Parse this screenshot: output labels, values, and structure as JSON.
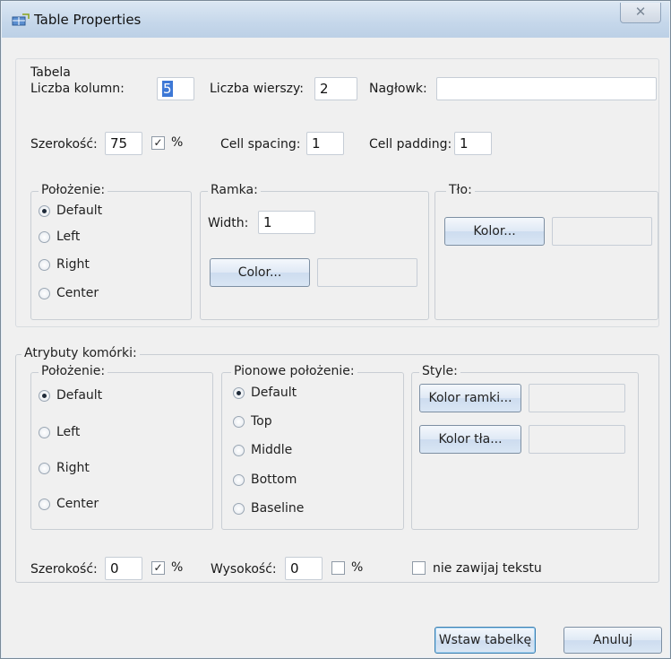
{
  "window": {
    "title": "Table Properties",
    "close_glyph": "✕"
  },
  "tabela": {
    "heading": "Tabela",
    "columns_label": "Liczba kolumn:",
    "columns_value": "5",
    "rows_label": "Liczba wierszy:",
    "rows_value": "2",
    "header_label": "Nagłowk:",
    "header_value": "",
    "width_label": "Szerokość:",
    "width_value": "75",
    "width_percent_checked": true,
    "percent_sign": "%",
    "spacing_label": "Cell spacing:",
    "spacing_value": "1",
    "padding_label": "Cell padding:",
    "padding_value": "1"
  },
  "polozenie": {
    "legend": "Położenie:",
    "options": [
      "Default",
      "Left",
      "Right",
      "Center"
    ],
    "selected": "Default"
  },
  "ramka": {
    "legend": "Ramka:",
    "width_label": "Width:",
    "width_value": "1",
    "color_button": "Color..."
  },
  "tlo": {
    "legend": "Tło:",
    "color_button": "Kolor..."
  },
  "atrybuty": {
    "legend": "Atrybuty komórki:",
    "polozenie": {
      "legend": "Położenie:",
      "options": [
        "Default",
        "Left",
        "Right",
        "Center"
      ],
      "selected": "Default"
    },
    "pionowe": {
      "legend": "Pionowe położenie:",
      "options": [
        "Default",
        "Top",
        "Middle",
        "Bottom",
        "Baseline"
      ],
      "selected": "Default"
    },
    "style": {
      "legend": "Style:",
      "border_color_button": "Kolor ramki...",
      "bg_color_button": "Kolor tła..."
    }
  },
  "cell_size": {
    "width_label": "Szerokość:",
    "width_value": "0",
    "width_percent_checked": true,
    "height_label": "Wysokość:",
    "height_value": "0",
    "height_percent_checked": false,
    "percent_sign": "%",
    "nowrap_label": "nie zawijaj tekstu",
    "nowrap_checked": false
  },
  "footer": {
    "insert_button": "Wstaw tabelkę",
    "cancel_button": "Anuluj"
  },
  "colors": {
    "titlebar": "#c5d7ea",
    "selection": "#3d78d6",
    "dialog_bg": "#f0f0f0"
  }
}
